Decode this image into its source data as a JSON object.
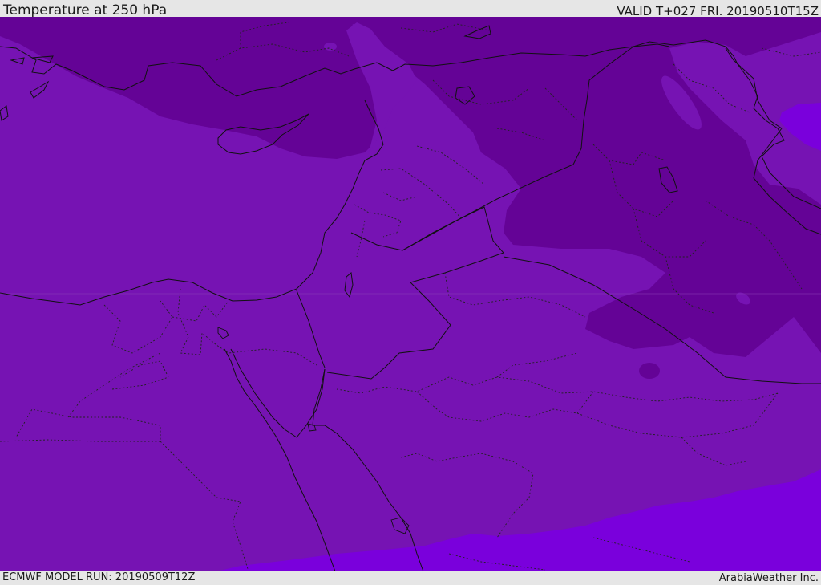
{
  "header": {
    "title": "Temperature at 250 hPa",
    "valid": "VALID T+027 FRI. 20190510T15Z"
  },
  "footer": {
    "model_run": "ECMWF MODEL RUN: 20190509T12Z",
    "credit": "ArabiaWeather Inc."
  },
  "colors": {
    "field_base": "#7613b3",
    "field_cold": "#640396",
    "field_warm": "#7a00dc",
    "coastline": "#111111",
    "border": "#111111",
    "province": "#222222",
    "bar_bg": "#e6e6e6"
  }
}
